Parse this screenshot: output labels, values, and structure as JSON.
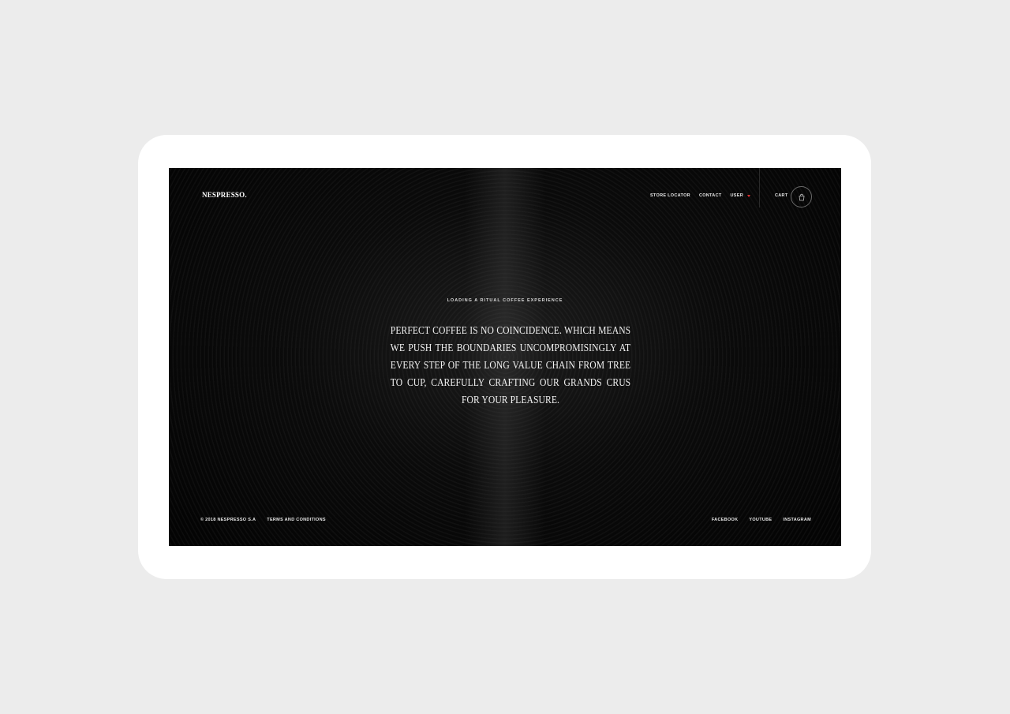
{
  "brand": {
    "logo_text": "NESPRESSO."
  },
  "nav": {
    "store_locator": "STORE LOCATOR",
    "contact": "CONTACT",
    "user": "USER",
    "cart": "CART"
  },
  "hero": {
    "loading_label": "LOADING A RITUAL COFFEE EXPERIENCE",
    "headline": "PERFECT COFFEE IS NO COINCIDENCE. WHICH MEANS WE PUSH THE BOUNDARIES UNCOMPROMISINGLY AT EVERY STEP OF THE LONG VALUE CHAIN FROM TREE TO CUP, CAREFULLY CRAFTING OUR GRANDS CRUS FOR YOUR PLEASURE."
  },
  "footer": {
    "copyright": "© 2018 NESPRESSO S.A",
    "terms": "TERMS AND CONDITIONS",
    "social": [
      "FACEBOOK",
      "YOUTUBE",
      "INSTAGRAM"
    ]
  },
  "colors": {
    "page_background": "#ececec",
    "device_frame": "#ffffff",
    "screen_background": "#050505",
    "text": "#ffffff",
    "user_caret_accent": "#e03030"
  },
  "icons": {
    "cart": "shopping-bag-icon",
    "user_dropdown": "caret-down-icon"
  }
}
